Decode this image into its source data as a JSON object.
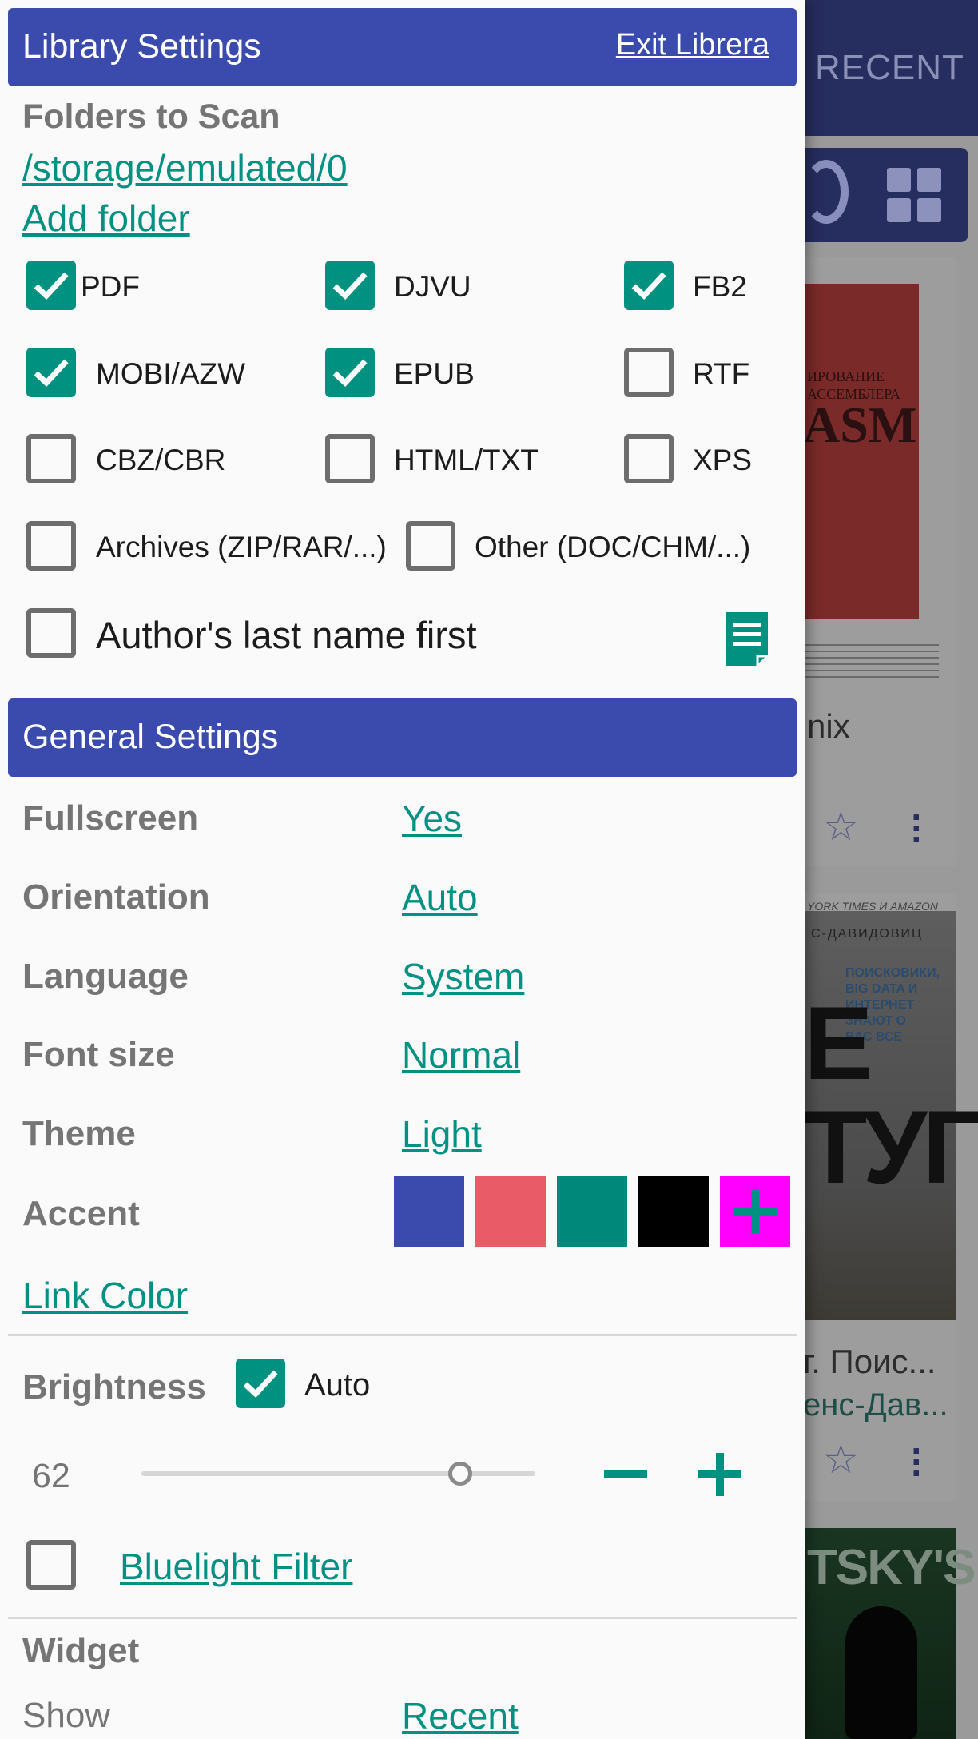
{
  "background": {
    "tab_label": "RECENT",
    "book1_cover_title": "ASM",
    "book1_cover_subtitle": "ИРОВАНИЕ АССЕМБЛЕРА",
    "book1_title": "nix",
    "book2_cover_title": "E\nТУГ",
    "book2_cover_top": "YORK TIMES И AMAZON",
    "book2_cover_author": "С-ДАВИДОВИЦ",
    "book2_cover_blurb": "ПОИСКОВИКИ, BIG DATA И ИНТЕРНЕТ ЗНАЮТ О ВАС ВСЕ",
    "book2_title": "г. Поис...",
    "book2_author": "енс-Дав...",
    "book3_cover_title": "TSKY'S"
  },
  "library": {
    "header_title": "Library Settings",
    "exit_label": "Exit Librera",
    "folders_label": "Folders to Scan",
    "folder_path": "/storage/emulated/0",
    "add_folder_label": "Add folder",
    "formats": [
      {
        "label": "PDF",
        "checked": true
      },
      {
        "label": "DJVU",
        "checked": true
      },
      {
        "label": "FB2",
        "checked": true
      },
      {
        "label": "MOBI/AZW",
        "checked": true
      },
      {
        "label": "EPUB",
        "checked": true
      },
      {
        "label": "RTF",
        "checked": false
      },
      {
        "label": "CBZ/CBR",
        "checked": false
      },
      {
        "label": "HTML/TXT",
        "checked": false
      },
      {
        "label": "XPS",
        "checked": false
      },
      {
        "label": "Archives (ZIP/RAR/...)",
        "checked": false
      },
      {
        "label": "Other (DOC/CHM/...)",
        "checked": false
      }
    ],
    "author_last_name_first": {
      "label": "Author's last name first",
      "checked": false
    }
  },
  "general": {
    "header_title": "General Settings",
    "rows": [
      {
        "label": "Fullscreen",
        "value": "Yes"
      },
      {
        "label": "Orientation",
        "value": "Auto"
      },
      {
        "label": "Language",
        "value": "System"
      },
      {
        "label": "Font size",
        "value": "Normal"
      },
      {
        "label": "Theme",
        "value": "Light"
      }
    ],
    "accent_label": "Accent",
    "accent_colors": [
      "#3b4aad",
      "#ea5b68",
      "#00897b",
      "#000000",
      "#ff00ff"
    ],
    "link_color_label": "Link Color",
    "brightness_label": "Brightness",
    "brightness_auto_label": "Auto",
    "brightness_auto_checked": true,
    "brightness_value": "62",
    "brightness_level": 0.62,
    "bluelight_label": "Bluelight Filter",
    "bluelight_checked": false
  },
  "widget": {
    "title": "Widget",
    "show_label": "Show",
    "show_value": "Recent"
  },
  "colors": {
    "header_bar": "#3b4aad",
    "accent": "#009181",
    "link": "#009183"
  }
}
